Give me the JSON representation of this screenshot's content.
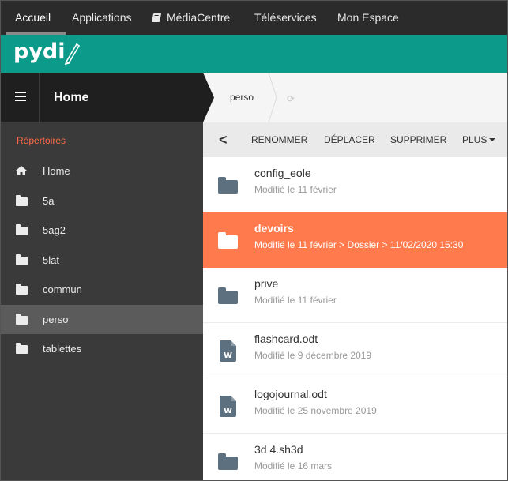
{
  "topnav": {
    "items": [
      "Accueil",
      "Applications",
      "MédiaCentre",
      "Téléservices",
      "Mon Espace"
    ]
  },
  "brand": {
    "logo_text": "pydi"
  },
  "sidebar": {
    "title": "Home",
    "section_label": "Répertoires",
    "tree": [
      {
        "label": "Home",
        "icon": "home-icon"
      },
      {
        "label": "5a",
        "icon": "folder-icon"
      },
      {
        "label": "5ag2",
        "icon": "folder-icon"
      },
      {
        "label": "5lat",
        "icon": "folder-icon"
      },
      {
        "label": "commun",
        "icon": "folder-icon"
      },
      {
        "label": "perso",
        "icon": "folder-icon",
        "selected": true
      },
      {
        "label": "tablettes",
        "icon": "folder-icon"
      }
    ]
  },
  "breadcrumb": {
    "current": "perso"
  },
  "toolbar": {
    "back": "<",
    "rename": "RENOMMER",
    "move": "DÉPLACER",
    "delete": "SUPPRIMER",
    "more": "PLUS"
  },
  "files": [
    {
      "name": "config_eole",
      "meta": "Modifié le 11 février",
      "type": "folder"
    },
    {
      "name": "devoirs",
      "meta": "Modifié le 11 février  >  Dossier  >  11/02/2020 15:30",
      "type": "folder",
      "selected": true
    },
    {
      "name": "prive",
      "meta": "Modifié le 11 février",
      "type": "folder"
    },
    {
      "name": "flashcard.odt",
      "meta": "Modifié le 9 décembre 2019",
      "type": "document"
    },
    {
      "name": "logojournal.odt",
      "meta": "Modifié le 25 novembre 2019",
      "type": "document"
    },
    {
      "name": "3d 4.sh3d",
      "meta": "Modifié le 16 mars",
      "type": "folder"
    }
  ],
  "colors": {
    "topnav_bg": "#2b2b2b",
    "brand_bg": "#0c9a8a",
    "sidebar_bg": "#3a3a3a",
    "section_label": "#ff6a45",
    "selected_row": "#ff7b4d",
    "folder_icon": "#5c7080"
  }
}
